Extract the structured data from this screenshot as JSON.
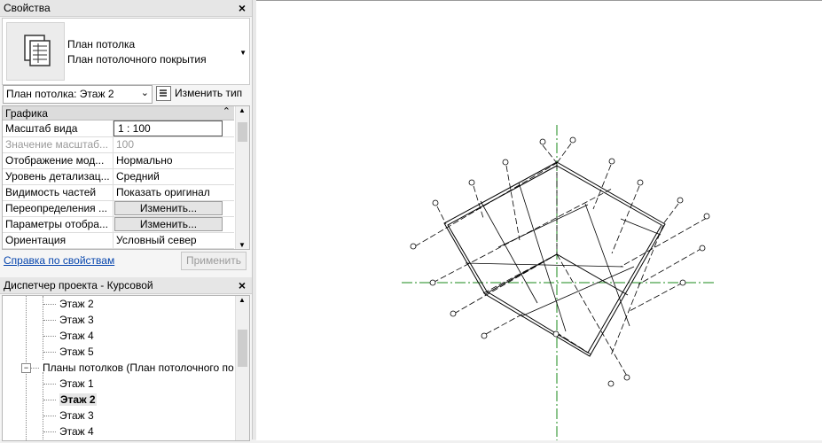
{
  "properties_panel": {
    "title": "Свойства",
    "close": "×",
    "type_name_line1": "План потолка",
    "type_name_line2": "План потолочного покрытия",
    "view_selector": "План потолка: Этаж 2",
    "edit_type_label": "Изменить тип",
    "group_header": "Графика",
    "rows": [
      {
        "name": "Масштаб вида",
        "value": "1 : 100"
      },
      {
        "name": "Значение масштаб...",
        "value": "100"
      },
      {
        "name": "Отображение мод...",
        "value": "Нормально"
      },
      {
        "name": "Уровень детализац...",
        "value": "Средний"
      },
      {
        "name": "Видимость частей",
        "value": "Показать оригинал"
      },
      {
        "name": "Переопределения ...",
        "value": "Изменить..."
      },
      {
        "name": "Параметры отобра...",
        "value": "Изменить..."
      },
      {
        "name": "Ориентация",
        "value": "Условный север"
      }
    ],
    "help_link": "Справка по свойствам",
    "apply_button": "Применить"
  },
  "project_browser": {
    "title": "Диспетчер проекта - Курсовой",
    "close": "×",
    "items": [
      {
        "label": "Этаж 2"
      },
      {
        "label": "Этаж 3"
      },
      {
        "label": "Этаж 4"
      },
      {
        "label": "Этаж 5"
      },
      {
        "label": "Планы потолков (План потолочного по"
      },
      {
        "label": "Этаж 1"
      },
      {
        "label": "Этаж 2"
      },
      {
        "label": "Этаж 3"
      },
      {
        "label": "Этаж 4"
      }
    ]
  },
  "colors": {
    "selected_bg": "#e6e6e6",
    "link": "#0645ad",
    "center_axis": "#1a8a1a"
  }
}
